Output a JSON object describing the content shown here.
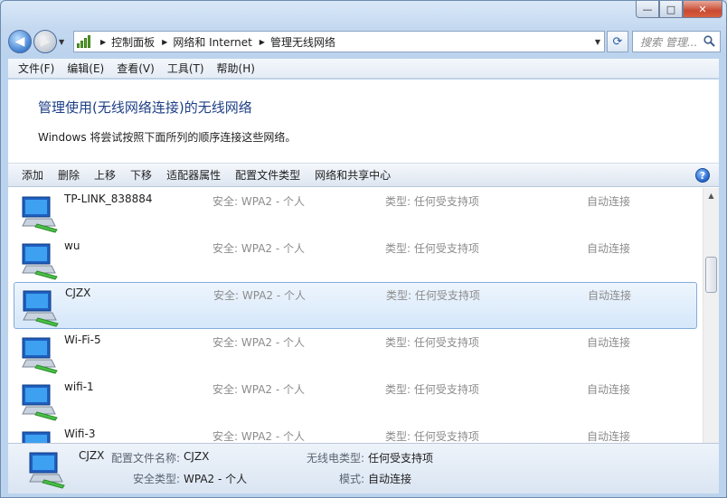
{
  "window": {
    "minimize_glyph": "—",
    "maximize_glyph": "□",
    "close_glyph": "✕"
  },
  "nav": {
    "back_glyph": "◀",
    "forward_glyph": "▶",
    "dropdown_glyph": "▼",
    "breadcrumbs": [
      "控制面板",
      "网络和 Internet",
      "管理无线网络"
    ],
    "refresh_glyph": "⟳",
    "search_placeholder": "搜索 管理..."
  },
  "menu": [
    "文件(F)",
    "编辑(E)",
    "查看(V)",
    "工具(T)",
    "帮助(H)"
  ],
  "page": {
    "title": "管理使用(无线网络连接)的无线网络",
    "description": "Windows 将尝试按照下面所列的顺序连接这些网络。"
  },
  "toolbar": {
    "buttons": [
      "添加",
      "删除",
      "上移",
      "下移",
      "适配器属性",
      "配置文件类型",
      "网络和共享中心"
    ],
    "help_glyph": "?"
  },
  "networks": [
    {
      "name": "TP-LINK_838884",
      "security": "安全: WPA2 - 个人",
      "type": "类型: 任何受支持项",
      "mode": "自动连接"
    },
    {
      "name": "wu",
      "security": "安全: WPA2 - 个人",
      "type": "类型: 任何受支持项",
      "mode": "自动连接"
    },
    {
      "name": "CJZX",
      "security": "安全: WPA2 - 个人",
      "type": "类型: 任何受支持项",
      "mode": "自动连接"
    },
    {
      "name": "Wi-Fi-5",
      "security": "安全: WPA2 - 个人",
      "type": "类型: 任何受支持项",
      "mode": "自动连接"
    },
    {
      "name": "wifi-1",
      "security": "安全: WPA2 - 个人",
      "type": "类型: 任何受支持项",
      "mode": "自动连接"
    },
    {
      "name": "Wifi-3",
      "security": "安全: WPA2 - 个人",
      "type": "类型: 任何受支持项",
      "mode": "自动连接"
    }
  ],
  "details": {
    "name": "CJZX",
    "profile_label": "配置文件名称:",
    "profile_value": "CJZX",
    "radio_label": "无线电类型:",
    "radio_value": "任何受支持项",
    "security_label": "安全类型:",
    "security_value": "WPA2 - 个人",
    "mode_label": "模式:",
    "mode_value": "自动连接"
  },
  "colors": {
    "title_blue": "#1e3f86",
    "selection_border": "#84acdd",
    "secondary_text": "#8c8c8c"
  }
}
